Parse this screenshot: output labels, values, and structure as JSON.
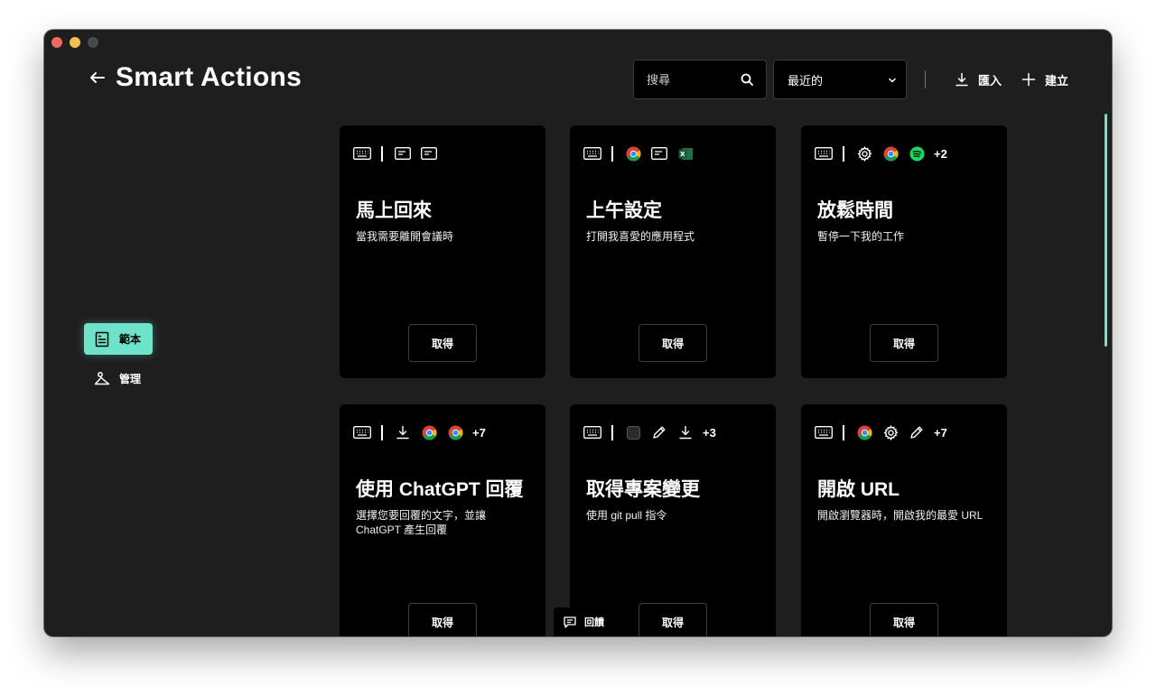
{
  "header": {
    "title": "Smart Actions",
    "search_placeholder": "搜尋",
    "sort_value": "最近的",
    "import_label": "匯入",
    "create_label": "建立"
  },
  "nav": {
    "templates_label": "範本",
    "manage_label": "管理"
  },
  "colors": {
    "accent": "#6fe3c9",
    "window_bg": "#1e1e1e",
    "card_bg": "#000000"
  },
  "cards": [
    {
      "title": "馬上回來",
      "description": "當我需要離開會議時",
      "button": "取得",
      "icons": [
        "keyboard-icon",
        "window-icon",
        "window-icon"
      ],
      "more": ""
    },
    {
      "title": "上午設定",
      "description": "打開我喜愛的應用程式",
      "button": "取得",
      "icons": [
        "keyboard-icon",
        "chrome-icon",
        "window-icon",
        "excel-icon"
      ],
      "more": ""
    },
    {
      "title": "放鬆時間",
      "description": "暫停一下我的工作",
      "button": "取得",
      "icons": [
        "keyboard-icon",
        "gear-icon",
        "chrome-icon",
        "spotify-icon"
      ],
      "more": "+2"
    },
    {
      "title": "使用 ChatGPT 回覆",
      "description": "選擇您要回覆的文字，並讓 ChatGPT 產生回覆",
      "button": "取得",
      "icons": [
        "keyboard-icon",
        "download-icon",
        "chrome-icon",
        "chrome-icon"
      ],
      "more": "+7"
    },
    {
      "title": "取得專案變更",
      "description": "使用 git pull 指令",
      "button": "取得",
      "icons": [
        "keyboard-icon",
        "terminal-icon",
        "pencil-icon",
        "download-icon"
      ],
      "more": "+3"
    },
    {
      "title": "開啟 URL",
      "description": "開啟瀏覽器時，開啟我的最愛 URL",
      "button": "取得",
      "icons": [
        "keyboard-icon",
        "chrome-icon",
        "gear-icon",
        "pencil-icon"
      ],
      "more": "+7"
    }
  ],
  "feedback_label": "回饋"
}
